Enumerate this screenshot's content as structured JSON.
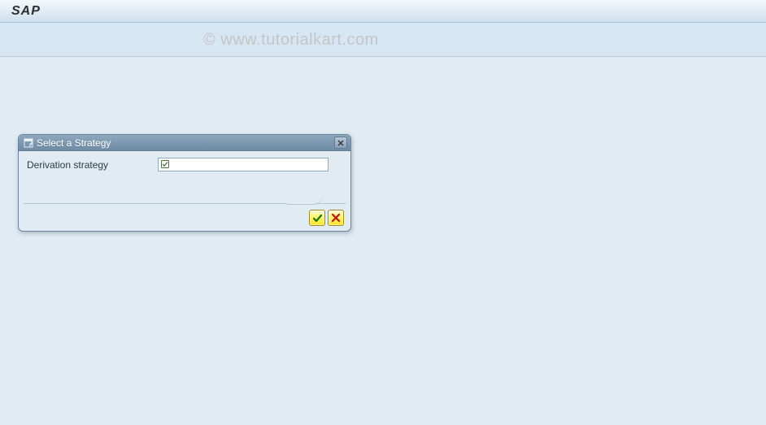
{
  "header": {
    "title": "SAP"
  },
  "watermark": "© www.tutorialkart.com",
  "dialog": {
    "title": "Select a Strategy",
    "title_icon": "dialog-icon",
    "close_icon": "close-icon",
    "field_label": "Derivation strategy",
    "field_value": "",
    "input_icon": "search-help-icon",
    "ok_icon": "check-icon",
    "cancel_icon": "x-icon"
  }
}
